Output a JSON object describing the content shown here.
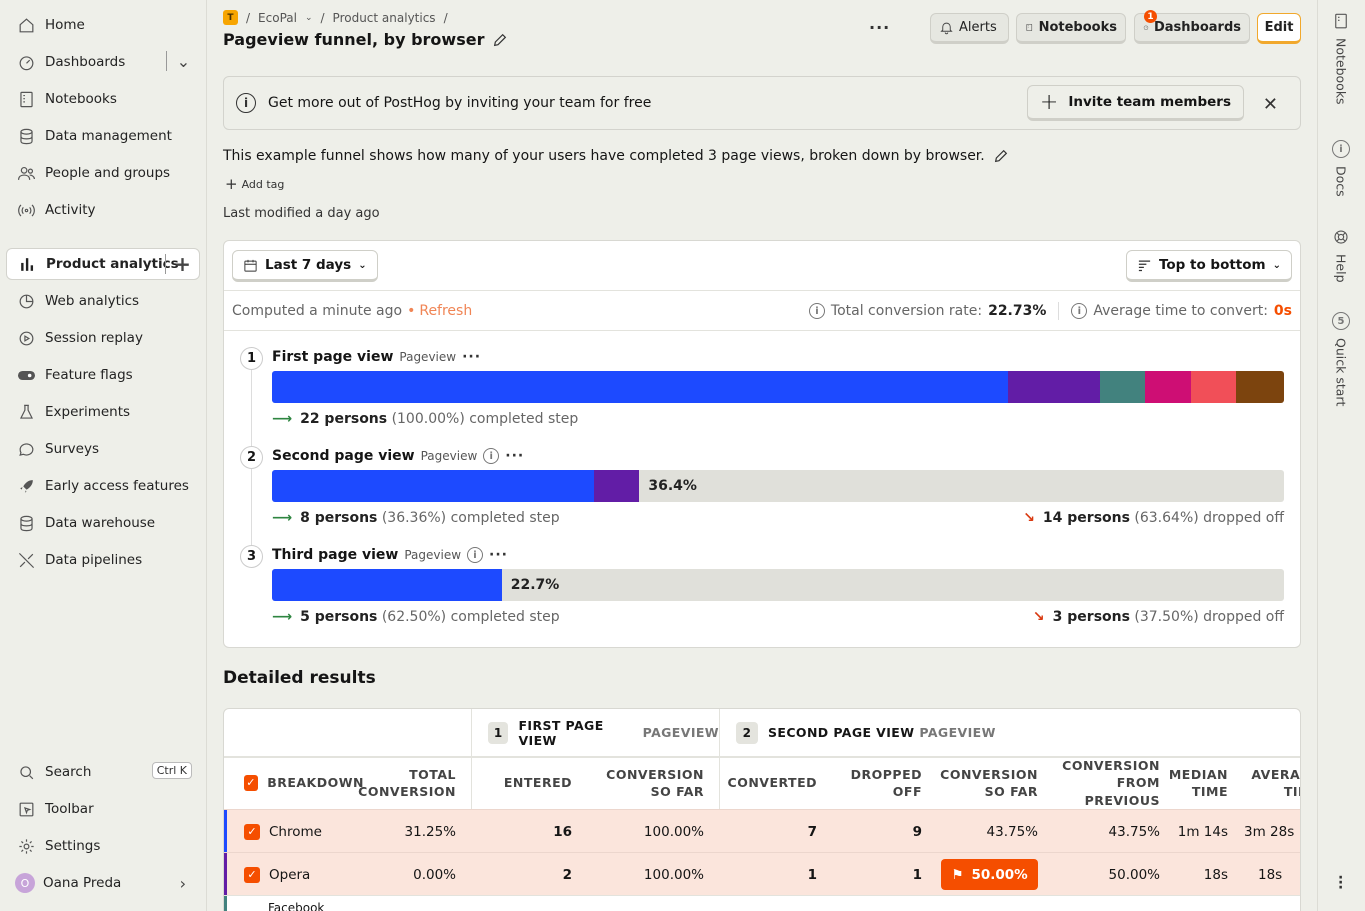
{
  "sidebar": {
    "items": [
      {
        "label": "Home",
        "icon": "home-icon"
      },
      {
        "label": "Dashboards",
        "icon": "dashboard-icon"
      },
      {
        "label": "Notebooks",
        "icon": "notebook-icon"
      },
      {
        "label": "Data management",
        "icon": "database-icon"
      },
      {
        "label": "People and groups",
        "icon": "people-icon"
      },
      {
        "label": "Activity",
        "icon": "activity-icon"
      },
      {
        "label": "Product analytics",
        "icon": "bar-chart-icon"
      },
      {
        "label": "Web analytics",
        "icon": "pie-chart-icon"
      },
      {
        "label": "Session replay",
        "icon": "play-icon"
      },
      {
        "label": "Feature flags",
        "icon": "toggle-icon"
      },
      {
        "label": "Experiments",
        "icon": "flask-icon"
      },
      {
        "label": "Surveys",
        "icon": "chat-icon"
      },
      {
        "label": "Early access features",
        "icon": "rocket-icon"
      },
      {
        "label": "Data warehouse",
        "icon": "database-icon"
      },
      {
        "label": "Data pipelines",
        "icon": "pipeline-icon"
      }
    ],
    "bottom": [
      {
        "label": "Search",
        "icon": "search-icon",
        "shortcut": "Ctrl K"
      },
      {
        "label": "Toolbar",
        "icon": "toolbar-icon"
      },
      {
        "label": "Settings",
        "icon": "gear-icon"
      },
      {
        "label": "Oana Preda",
        "icon": "avatar",
        "initial": "O"
      }
    ]
  },
  "header": {
    "project_initial": "T",
    "project": "EcoPal",
    "section": "Product analytics",
    "title": "Pageview funnel, by browser",
    "more": "···",
    "alerts": "Alerts",
    "notebooks": "Notebooks",
    "dashboards": "Dashboards",
    "dashboards_badge": "1",
    "edit": "Edit"
  },
  "banner": {
    "text": "Get more out of PostHog by inviting your team for free",
    "button": "Invite team members"
  },
  "description": "This example funnel shows how many of your users have completed 3 page views, broken down by browser.",
  "add_tag": "Add tag",
  "last_modified": "Last modified a day ago",
  "controls": {
    "date_range": "Last 7 days",
    "layout": "Top to bottom",
    "computed": "Computed a minute ago",
    "refresh": "Refresh",
    "total_conv_label": "Total conversion rate:",
    "total_conv_value": "22.73%",
    "avg_time_label": "Average time to convert:",
    "avg_time_value": "0s"
  },
  "steps": [
    {
      "num": "1",
      "name": "First page view",
      "event": "Pageview",
      "persons": "22 persons",
      "pct": "(100.00%) completed step",
      "drop_persons": "",
      "drop_pct": "",
      "bar_label": ""
    },
    {
      "num": "2",
      "name": "Second page view",
      "event": "Pageview",
      "persons": "8 persons",
      "pct": "(36.36%) completed step",
      "drop_persons": "14 persons",
      "drop_pct": "(63.64%) dropped off",
      "bar_label": "36.4%"
    },
    {
      "num": "3",
      "name": "Third page view",
      "event": "Pageview",
      "persons": "5 persons",
      "pct": "(62.50%) completed step",
      "drop_persons": "3 persons",
      "drop_pct": "(37.50%) dropped off",
      "bar_label": "22.7%"
    }
  ],
  "bars": {
    "colors": [
      "#1d4aff",
      "#621da6",
      "#42827e",
      "#ce0e74",
      "#f14f58",
      "#7c440e"
    ],
    "step1": [
      0.727,
      0.091,
      0.045,
      0.045,
      0.045,
      0.047
    ],
    "step2": [
      0.318,
      0.045
    ],
    "step3": [
      0.227
    ]
  },
  "detailed": {
    "title": "Detailed results",
    "group1_num": "1",
    "group1": "FIRST PAGE VIEW",
    "group1_ev": "PAGEVIEW",
    "group2_num": "2",
    "group2": "SECOND PAGE VIEW",
    "group2_ev": "PAGEVIEW",
    "cols": {
      "breakdown": "BREAKDOWN",
      "total_conversion": "TOTAL CONVERSION",
      "entered": "ENTERED",
      "conversion_so_far": "CONVERSION SO FAR",
      "converted": "CONVERTED",
      "dropped_off": "DROPPED OFF",
      "conversion_so_far2": "CONVERSION SO FAR",
      "conversion_from_prev": "CONVERSION FROM PREVIOUS",
      "median_time": "MEDIAN TIME",
      "average_time": "AVERAGE TIME"
    },
    "rows": [
      {
        "name": "Chrome",
        "color": "#1d4aff",
        "total": "31.25%",
        "entered": "16",
        "conv": "100.00%",
        "converted": "7",
        "dropped": "9",
        "conv2": "43.75%",
        "from_prev": "43.75%",
        "median": "1m 14s",
        "avg": "3m 28s"
      },
      {
        "name": "Opera",
        "color": "#621da6",
        "total": "0.00%",
        "entered": "2",
        "conv": "100.00%",
        "converted": "1",
        "dropped": "1",
        "conv2": "50.00%",
        "from_prev": "50.00%",
        "median": "18s",
        "avg": "18s"
      },
      {
        "name": "Facebook",
        "color": "#42827e"
      }
    ]
  },
  "right_panel": [
    {
      "label": "Notebooks",
      "icon": "notebook-icon"
    },
    {
      "label": "Docs",
      "icon": "info-icon"
    },
    {
      "label": "Help",
      "icon": "lifebuoy-icon"
    },
    {
      "label": "Quick start",
      "icon": "counter-icon",
      "count": "5"
    }
  ]
}
